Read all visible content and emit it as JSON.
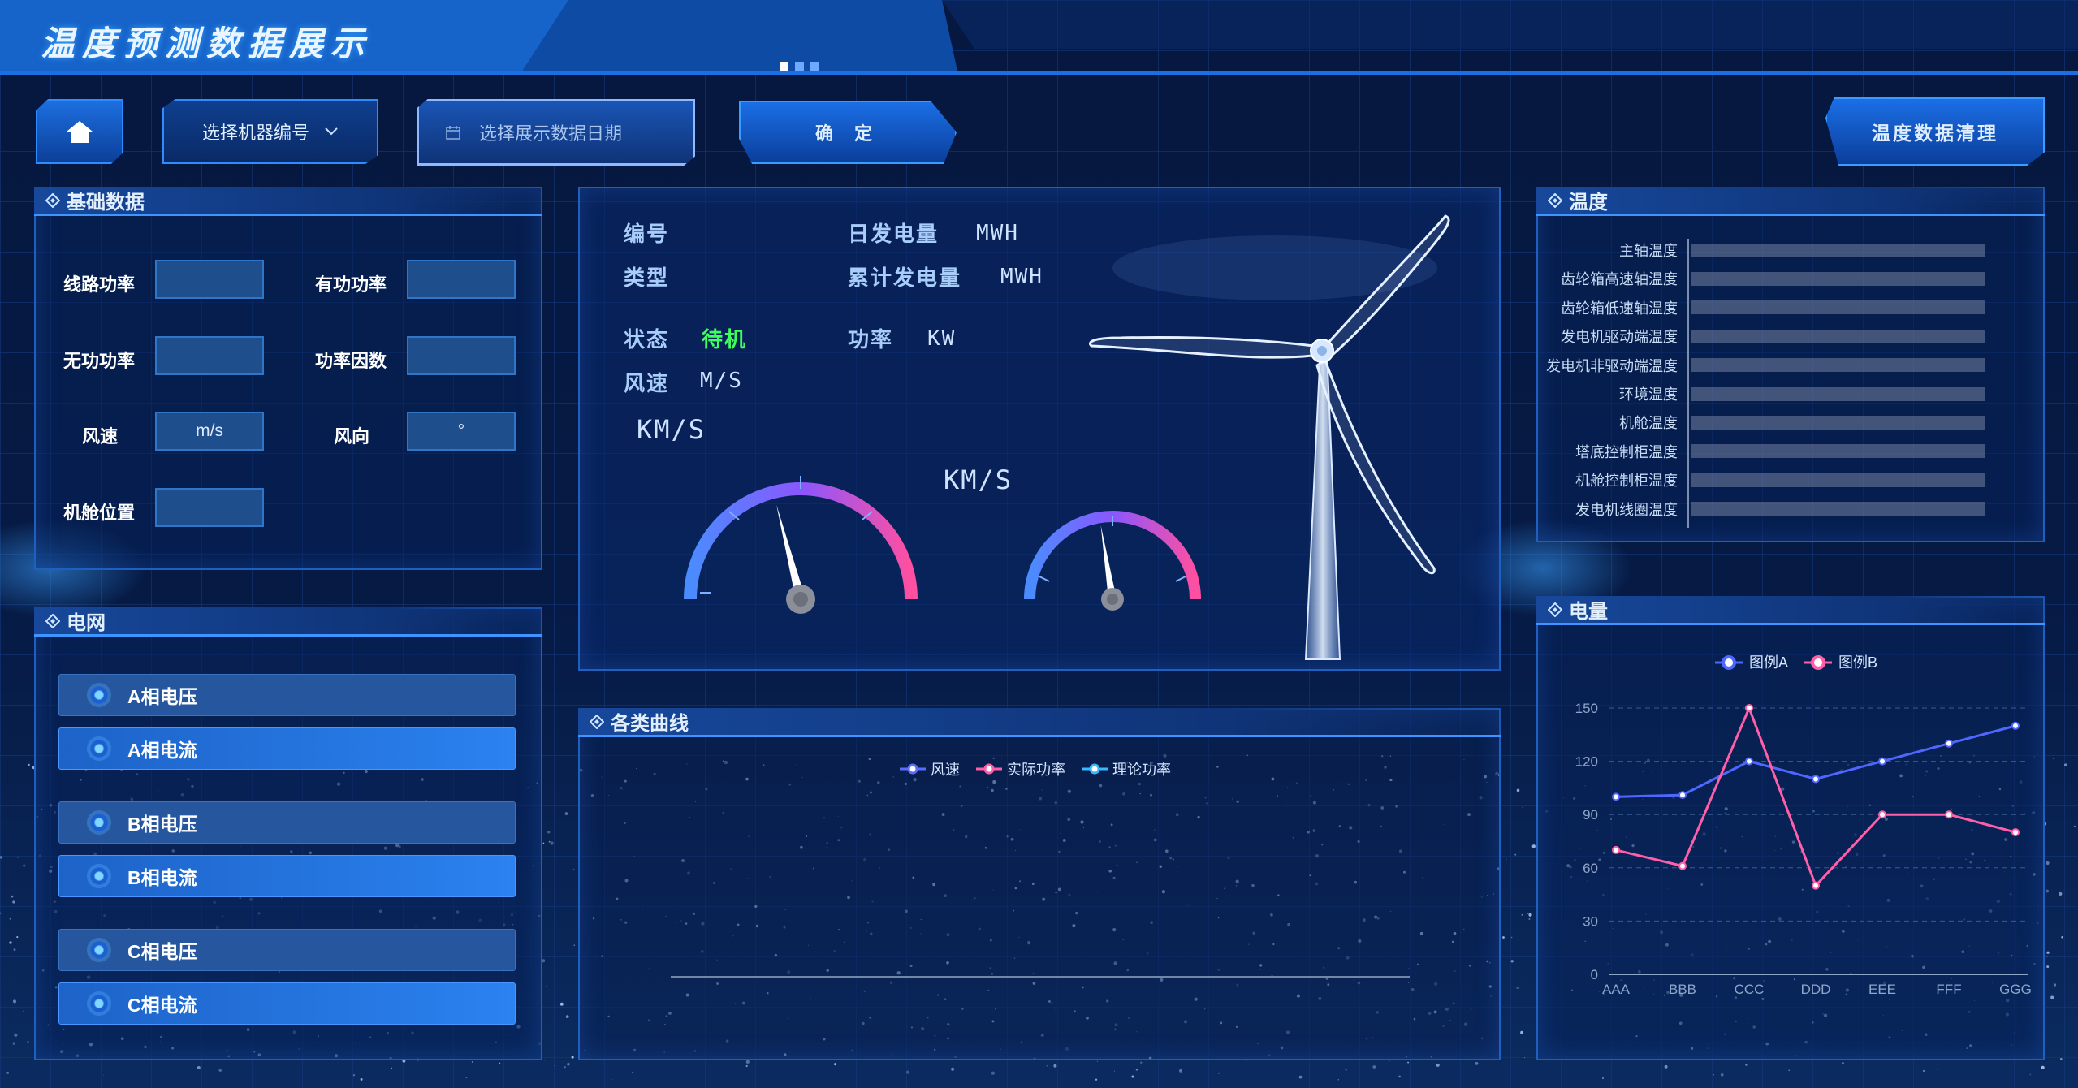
{
  "header": {
    "title": "温度预测数据展示"
  },
  "toolbar": {
    "home_icon": "home-icon",
    "machine_select": {
      "placeholder": "选择机器编号",
      "icon": "chevron-down-icon"
    },
    "date_picker": {
      "placeholder": "选择展示数据日期",
      "icon": "calendar-icon"
    },
    "confirm_label": "确 定",
    "clean_label": "温度数据清理"
  },
  "basic_data": {
    "title": "基础数据",
    "fields": [
      {
        "label": "线路功率",
        "value": ""
      },
      {
        "label": "有功功率",
        "value": ""
      },
      {
        "label": "无功功率",
        "value": ""
      },
      {
        "label": "功率因数",
        "value": ""
      },
      {
        "label": "风速",
        "value": "m/s"
      },
      {
        "label": "风向",
        "value": "°"
      },
      {
        "label": "机舱位置",
        "value": ""
      }
    ]
  },
  "grid": {
    "title": "电网",
    "items": [
      {
        "label": "A相电压"
      },
      {
        "label": "A相电流"
      },
      {
        "label": "B相电压"
      },
      {
        "label": "B相电流"
      },
      {
        "label": "C相电压"
      },
      {
        "label": "C相电流"
      }
    ]
  },
  "turbine_info": {
    "id_label": "编号",
    "type_label": "类型",
    "status_label": "状态",
    "status_value": "待机",
    "wind_label": "风速",
    "wind_unit": "M/S",
    "daily_label": "日发电量",
    "daily_unit": "MWH",
    "total_label": "累计发电量",
    "total_unit": "MWH",
    "power_label": "功率",
    "power_unit": "KW",
    "gauge1_unit": "KM/S",
    "gauge2_unit": "KM/S",
    "gauge1_fraction": 0.42,
    "gauge2_fraction": 0.45,
    "status_color": "#3dff5a"
  },
  "curves": {
    "title": "各类曲线",
    "legend": [
      "风速",
      "实际功率",
      "理论功率"
    ],
    "colors": [
      "#5b6cff",
      "#ff5fa8",
      "#37b8ff"
    ]
  },
  "temperature": {
    "title": "温度",
    "items": [
      "主轴温度",
      "齿轮箱高速轴温度",
      "齿轮箱低速轴温度",
      "发电机驱动端温度",
      "发电机非驱动端温度",
      "环境温度",
      "机舱温度",
      "塔底控制柜温度",
      "机舱控制柜温度",
      "发电机线圈温度"
    ]
  },
  "power": {
    "title": "电量",
    "chart_data": {
      "type": "line",
      "categories": [
        "AAA",
        "BBB",
        "CCC",
        "DDD",
        "EEE",
        "FFF",
        "GGG"
      ],
      "series": [
        {
          "name": "图例A",
          "values": [
            100,
            101,
            120,
            110,
            120,
            130,
            140
          ],
          "color": "#4f66ff"
        },
        {
          "name": "图例B",
          "values": [
            70,
            61,
            150,
            50,
            90,
            90,
            80
          ],
          "color": "#ff5fa8"
        }
      ],
      "yticks": [
        0,
        30,
        60,
        90,
        120,
        150
      ],
      "ylim": [
        0,
        150
      ],
      "grid": true,
      "legend": "top-center"
    }
  }
}
